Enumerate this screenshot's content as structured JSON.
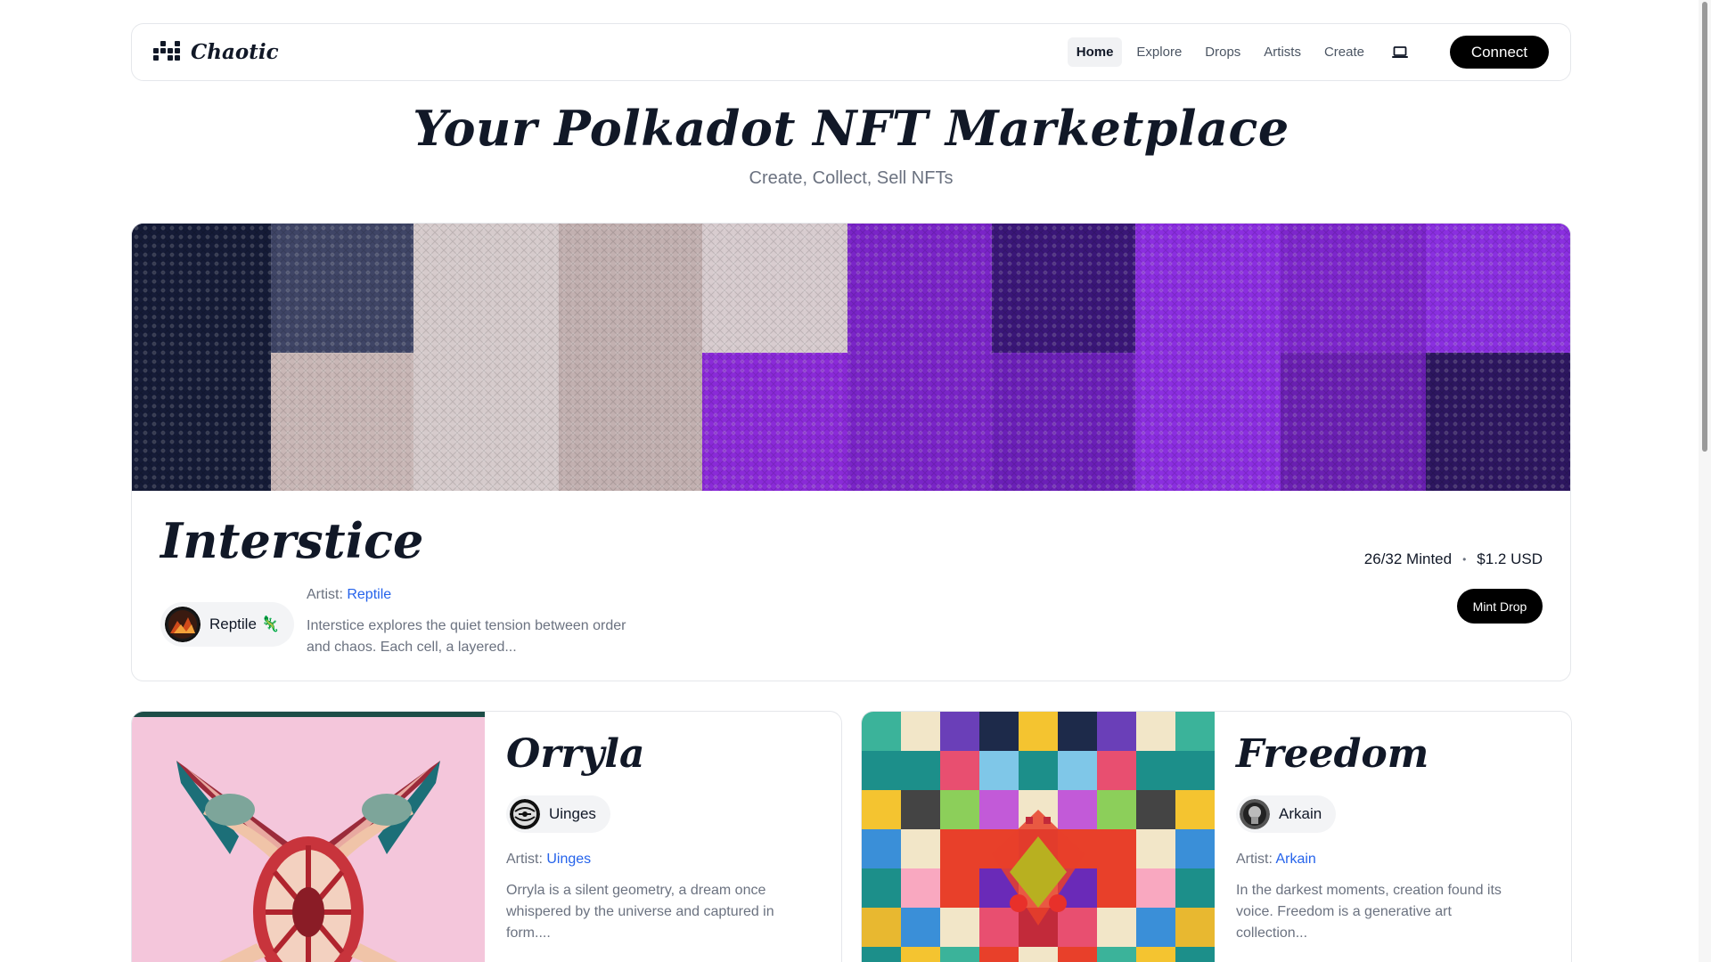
{
  "app": {
    "brand": "Chaotic",
    "brand_icon": "grid-dots-icon"
  },
  "nav": {
    "links": [
      {
        "label": "Home",
        "active": true
      },
      {
        "label": "Explore",
        "active": false
      },
      {
        "label": "Drops",
        "active": false
      },
      {
        "label": "Artists",
        "active": false
      },
      {
        "label": "Create",
        "active": false
      }
    ],
    "device_icon": "laptop-icon",
    "connect_label": "Connect"
  },
  "hero": {
    "title": "Your Polkadot NFT Marketplace",
    "subtitle": "Create, Collect, Sell NFTs"
  },
  "featured": {
    "title": "Interstice",
    "artist_chip": "Reptile 🦎",
    "artist_prefix": "Artist:",
    "artist_name": "Reptile",
    "description": "Interstice explores the quiet tension between order and chaos. Each cell, a layered...",
    "minted": "26/32 Minted",
    "separator": "•",
    "price": "$1.2 USD",
    "mint_label": "Mint Drop"
  },
  "cards": [
    {
      "title": "Orryla",
      "artist_chip": "Uinges",
      "artist_prefix": "Artist:",
      "artist_name": "Uinges",
      "description": "Orryla is a silent geometry, a dream once whispered by the universe and captured in form...."
    },
    {
      "title": "Freedom",
      "artist_chip": "Arkain",
      "artist_prefix": "Artist:",
      "artist_name": "Arkain",
      "description": "In the darkest moments, creation found its voice. Freedom is a generative art collection..."
    }
  ],
  "colors": {
    "accent_link": "#2563eb",
    "primary_button": "#000000",
    "banner_purple": "#7b22d6",
    "banner_navy": "#141a35",
    "banner_pink": "#cfc0c4"
  }
}
